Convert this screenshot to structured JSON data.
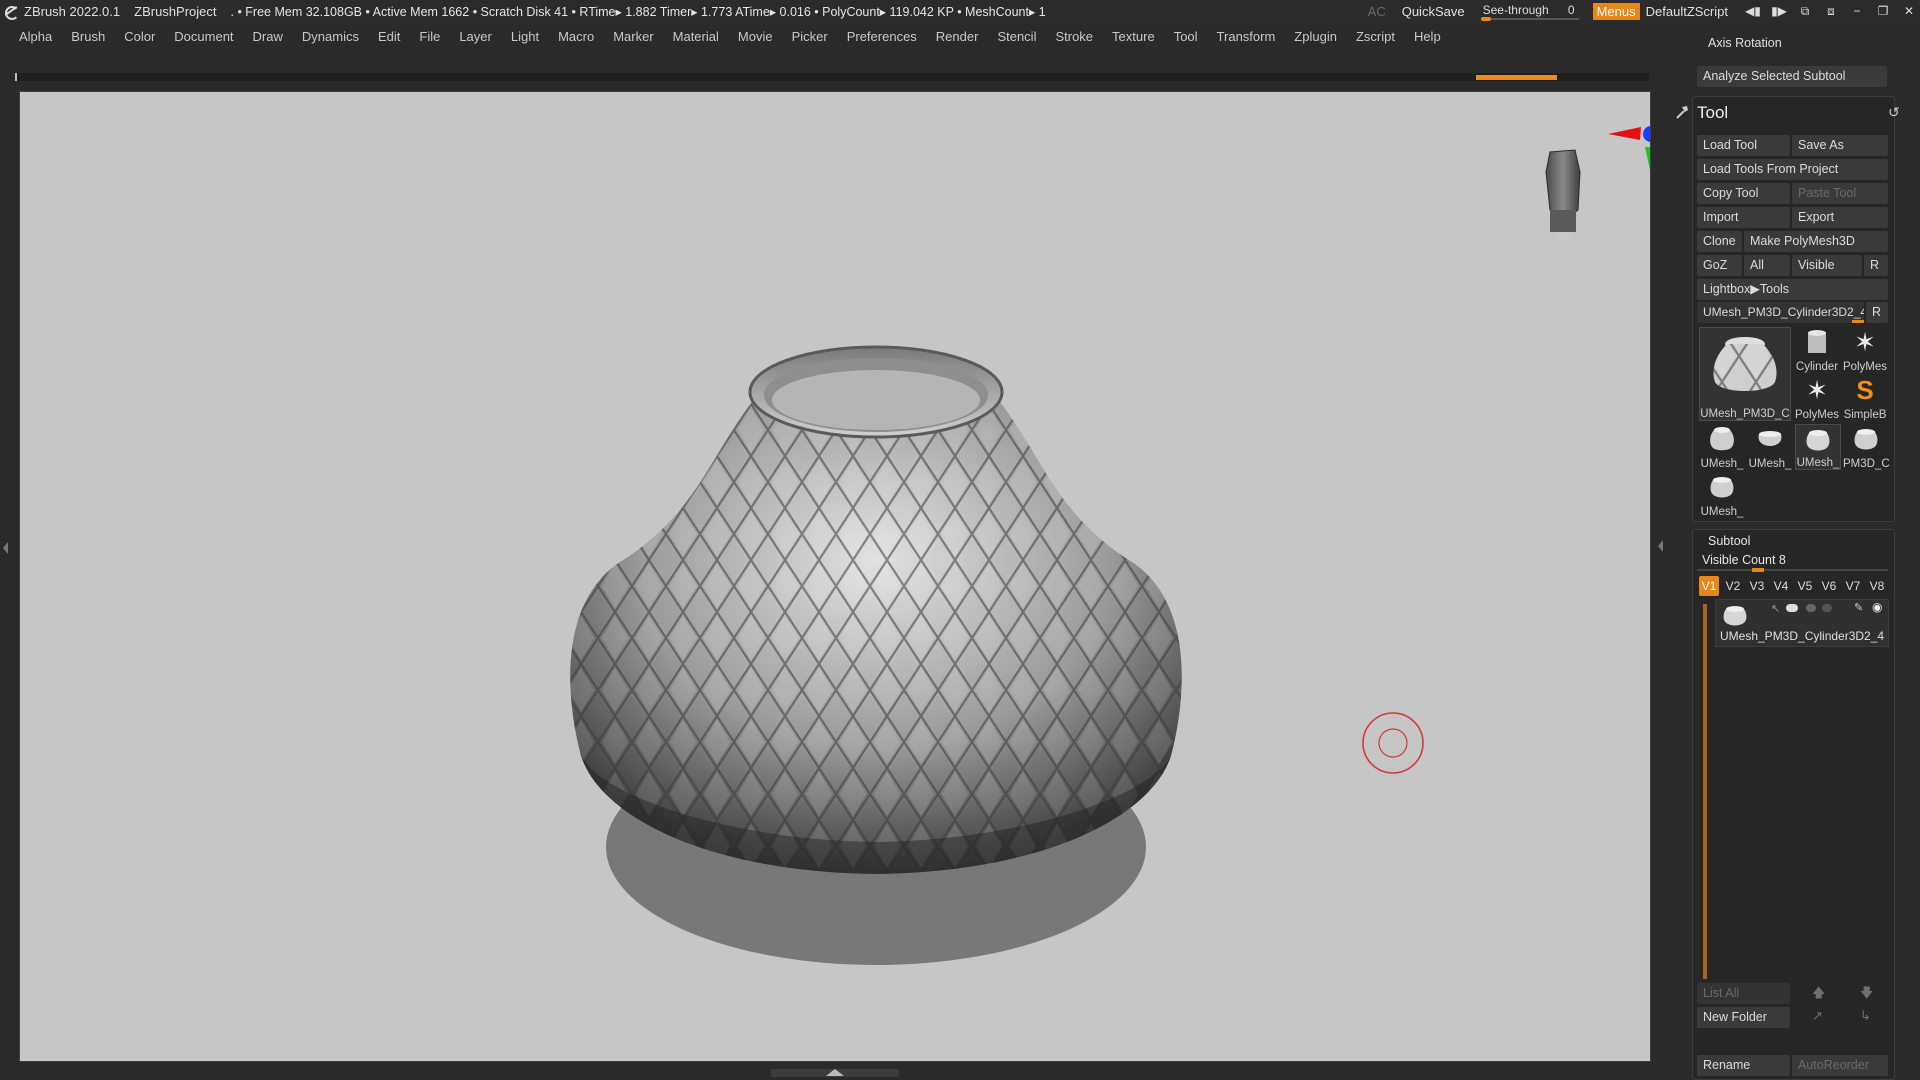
{
  "titlebar": {
    "app": "ZBrush 2022.0.1",
    "project": "ZBrushProject",
    "stats": ".  • Free Mem 32.108GB • Active Mem 1662 • Scratch Disk 41 •  RTime▸ 1.882 Timer▸ 1.773 ATime▸ 0.016 • PolyCount▸ 119.042 KP  • MeshCount▸ 1",
    "ac": "AC",
    "quicksave": "QuickSave",
    "seethrough_label": "See-through",
    "seethrough_value": "0",
    "menus": "Menus",
    "script": "DefaultZScript"
  },
  "menubar": [
    "Alpha",
    "Brush",
    "Color",
    "Document",
    "Draw",
    "Dynamics",
    "Edit",
    "File",
    "Layer",
    "Light",
    "Macro",
    "Marker",
    "Material",
    "Movie",
    "Picker",
    "Preferences",
    "Render",
    "Stencil",
    "Stroke",
    "Texture",
    "Tool",
    "Transform",
    "Zplugin",
    "Zscript",
    "Help"
  ],
  "rightpanel": {
    "axis_rotation": "Axis Rotation",
    "analyze": "Analyze Selected Subtool",
    "tool_title": "Tool",
    "buttons": {
      "load_tool": "Load Tool",
      "save_as": "Save As",
      "load_from_project": "Load Tools From Project",
      "copy_tool": "Copy Tool",
      "paste_tool": "Paste Tool",
      "import": "Import",
      "export": "Export",
      "clone": "Clone",
      "make_polymesh": "Make PolyMesh3D",
      "goz": "GoZ",
      "all": "All",
      "visible": "Visible",
      "r": "R",
      "lightbox": "Lightbox▶Tools",
      "current_tool": "UMesh_PM3D_Cylinder3D2_4",
      "r2": "R"
    },
    "thumbs": {
      "main": "UMesh_PM3D_C",
      "cylinder": "Cylinder",
      "polymesh1": "PolyMes",
      "polymesh2": "PolyMes",
      "simpleb": "SimpleB",
      "umesh1": "UMesh_",
      "umesh2": "UMesh_",
      "umesh3": "UMesh_",
      "pm3d": "PM3D_C",
      "umesh4": "UMesh_"
    },
    "subtool": {
      "title": "Subtool",
      "visible_count": "Visible Count 8",
      "tabs": [
        "V1",
        "V2",
        "V3",
        "V4",
        "V5",
        "V6",
        "V7",
        "V8"
      ],
      "item_name": "UMesh_PM3D_Cylinder3D2_4"
    },
    "bottom": {
      "list_all": "List All",
      "new_folder": "New Folder",
      "rename": "Rename",
      "autoreorder": "AutoReorder"
    }
  },
  "colors": {
    "accent": "#e8861a",
    "viewport_bg": "#c6c6c6",
    "panel_bg": "#2a2a2a",
    "axis_red": "#e21212",
    "axis_green": "#1fc41f",
    "axis_blue": "#1a3cff"
  }
}
